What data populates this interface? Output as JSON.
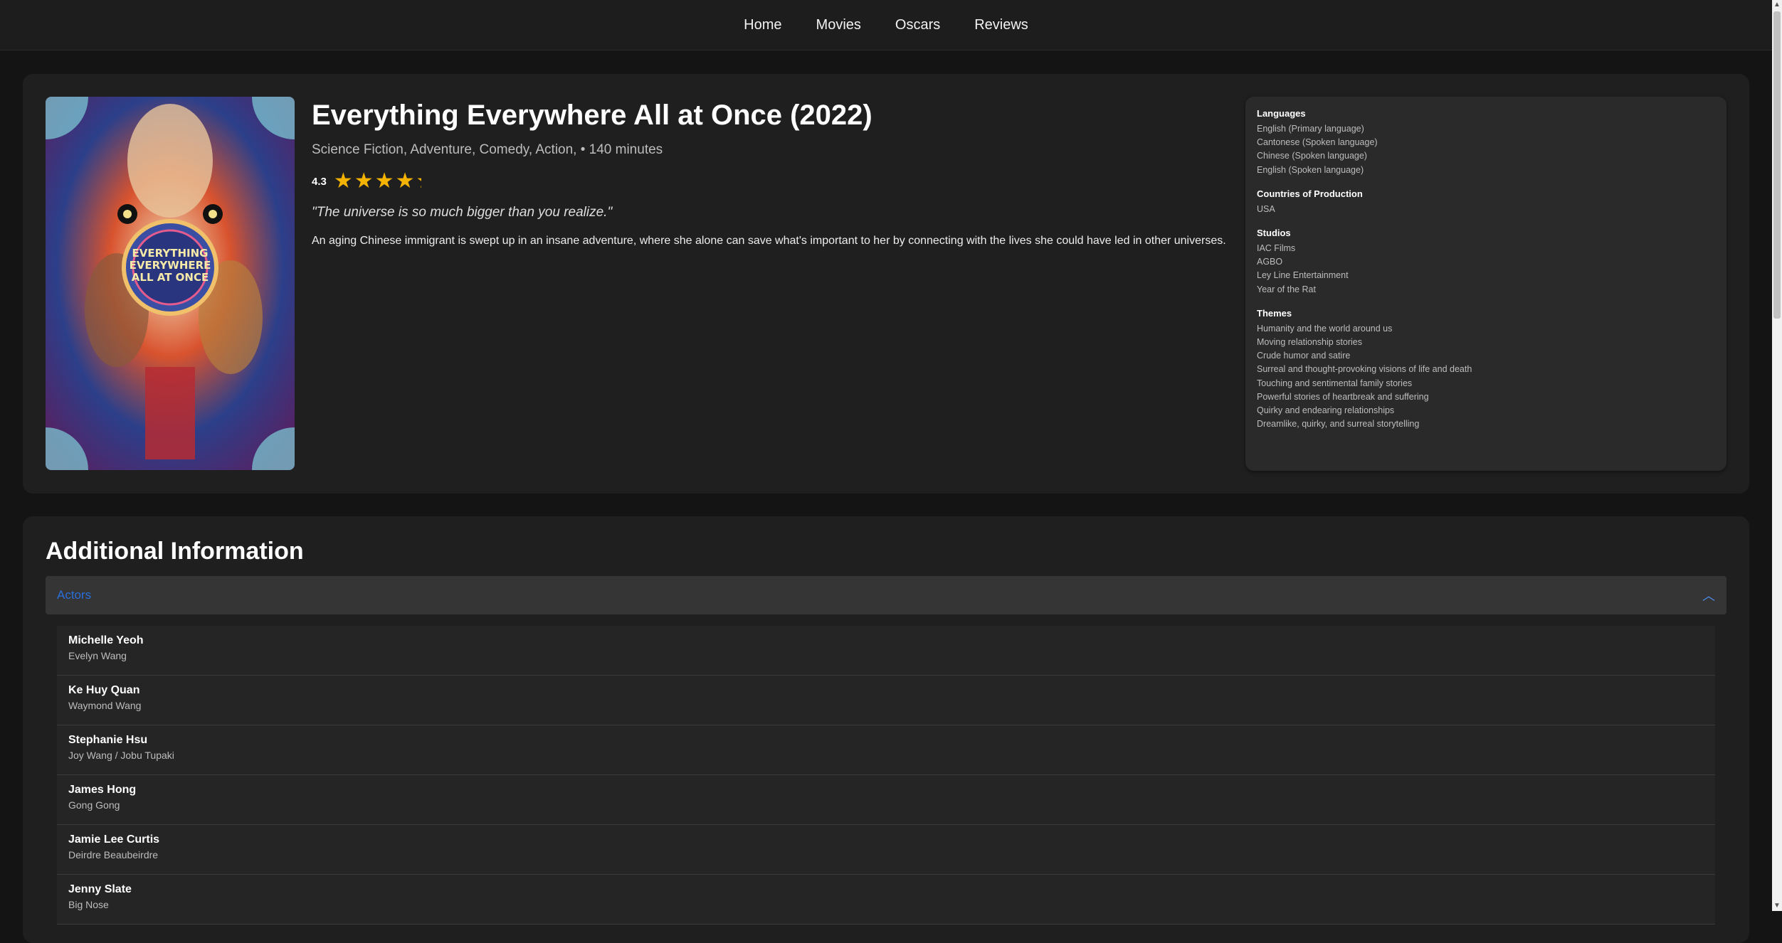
{
  "nav": {
    "items": [
      {
        "label": "Home"
      },
      {
        "label": "Movies"
      },
      {
        "label": "Oscars"
      },
      {
        "label": "Reviews"
      }
    ]
  },
  "movie": {
    "title": "Everything Everywhere All at Once (2022)",
    "genres_line": "Science Fiction, Adventure, Comedy, Action, • 140 minutes",
    "rating": "4.3",
    "rating_value": 4.3,
    "rating_max": 5,
    "tagline": "\"The universe is so much bigger than you realize.\"",
    "overview": "An aging Chinese immigrant is swept up in an insane adventure, where she alone can save what's important to her by connecting with the lives she could have led in other universes.",
    "poster_text": [
      "EVERYTHING",
      "EVERYWHERE",
      "ALL AT ONCE"
    ]
  },
  "details": {
    "languages": {
      "heading": "Languages",
      "items": [
        "English (Primary language)",
        "Cantonese (Spoken language)",
        "Chinese (Spoken language)",
        "English (Spoken language)"
      ]
    },
    "countries": {
      "heading": "Countries of Production",
      "items": [
        "USA"
      ]
    },
    "studios": {
      "heading": "Studios",
      "items": [
        "IAC Films",
        "AGBO",
        "Ley Line Entertainment",
        "Year of the Rat"
      ]
    },
    "themes": {
      "heading": "Themes",
      "items": [
        "Humanity and the world around us",
        "Moving relationship stories",
        "Crude humor and satire",
        "Surreal and thought-provoking visions of life and death",
        "Touching and sentimental family stories",
        "Powerful stories of heartbreak and suffering",
        "Quirky and endearing relationships",
        "Dreamlike, quirky, and surreal storytelling"
      ]
    }
  },
  "additional": {
    "title": "Additional Information",
    "accordion_label": "Actors",
    "actors": [
      {
        "name": "Michelle Yeoh",
        "role": "Evelyn Wang"
      },
      {
        "name": "Ke Huy Quan",
        "role": "Waymond Wang"
      },
      {
        "name": "Stephanie Hsu",
        "role": "Joy Wang / Jobu Tupaki"
      },
      {
        "name": "James Hong",
        "role": "Gong Gong"
      },
      {
        "name": "Jamie Lee Curtis",
        "role": "Deirdre Beaubeirdre"
      },
      {
        "name": "Jenny Slate",
        "role": "Big Nose"
      }
    ]
  },
  "colors": {
    "star": "#f5b301",
    "accent_link": "#2a6fdb"
  },
  "icons": {
    "chevron": "chevron-up-icon",
    "star": "star-icon"
  }
}
